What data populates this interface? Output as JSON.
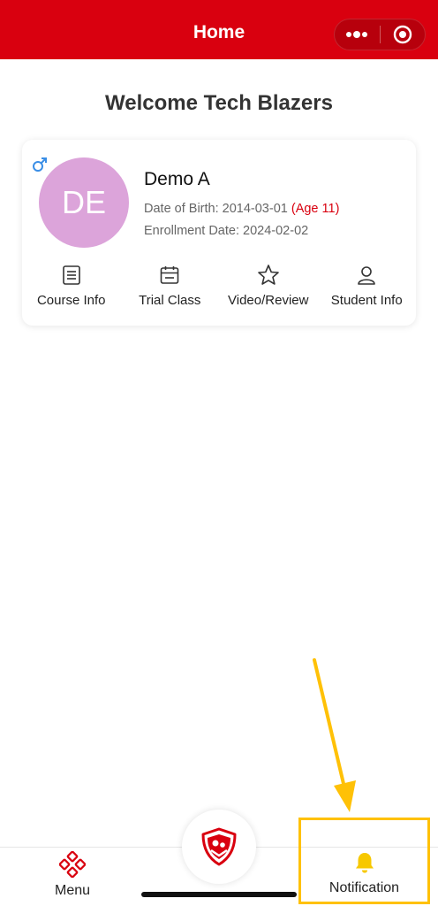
{
  "header": {
    "title": "Home"
  },
  "welcome": "Welcome Tech Blazers",
  "student": {
    "avatar_initials": "DE",
    "avatar_color": "#dca4da",
    "gender_icon": "male-icon",
    "name": "Demo A",
    "dob_label": "Date of Birth: 2014-03-01",
    "age": "(Age 11)",
    "enrollment": "Enrollment Date: 2024-02-02"
  },
  "actions": [
    {
      "icon": "document-icon",
      "label": "Course Info"
    },
    {
      "icon": "calendar-icon",
      "label": "Trial Class"
    },
    {
      "icon": "star-icon",
      "label": "Video/Review"
    },
    {
      "icon": "person-icon",
      "label": "Student Info"
    }
  ],
  "tabbar": {
    "menu_label": "Menu",
    "notification_label": "Notification",
    "logo_icon": "shield-logo"
  },
  "colors": {
    "brand_red": "#d9000f",
    "highlight_yellow": "#ffc107",
    "bell_yellow": "#f7c800"
  }
}
